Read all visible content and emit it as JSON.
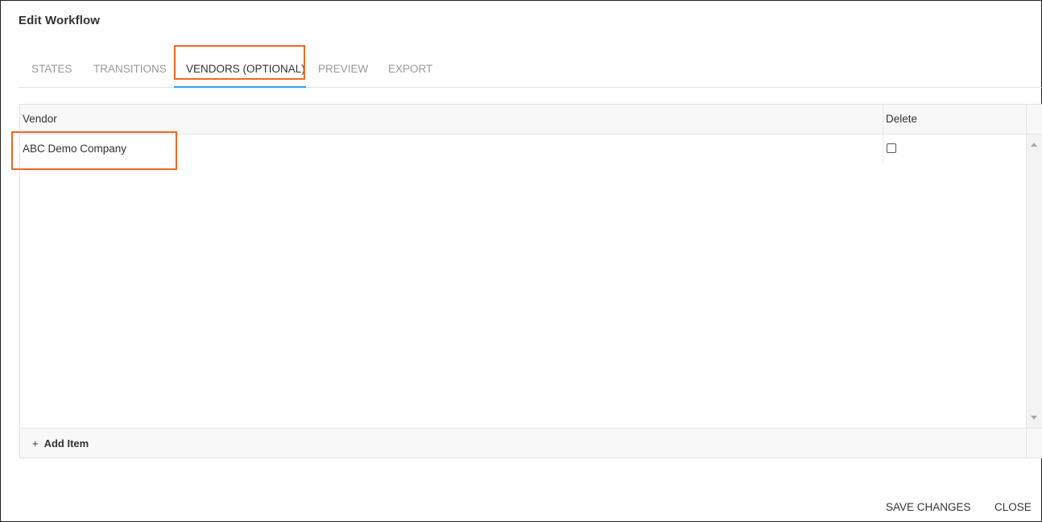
{
  "dialog": {
    "title": "Edit Workflow"
  },
  "tabs": [
    {
      "label": "STATES",
      "active": false
    },
    {
      "label": "TRANSITIONS",
      "active": false
    },
    {
      "label": "VENDORS (OPTIONAL)",
      "active": true
    },
    {
      "label": "PREVIEW",
      "active": false
    },
    {
      "label": "EXPORT",
      "active": false
    }
  ],
  "grid": {
    "columns": [
      "Vendor",
      "Delete"
    ],
    "rows": [
      {
        "vendor": "ABC Demo Company",
        "delete": false
      }
    ],
    "add_item": {
      "icon": "+",
      "label": "Add Item"
    }
  },
  "actions": {
    "save_label": "SAVE CHANGES",
    "close_label": "CLOSE"
  },
  "colors": {
    "highlight": "#f26722",
    "active_tab_underline": "#2aa4e0"
  }
}
